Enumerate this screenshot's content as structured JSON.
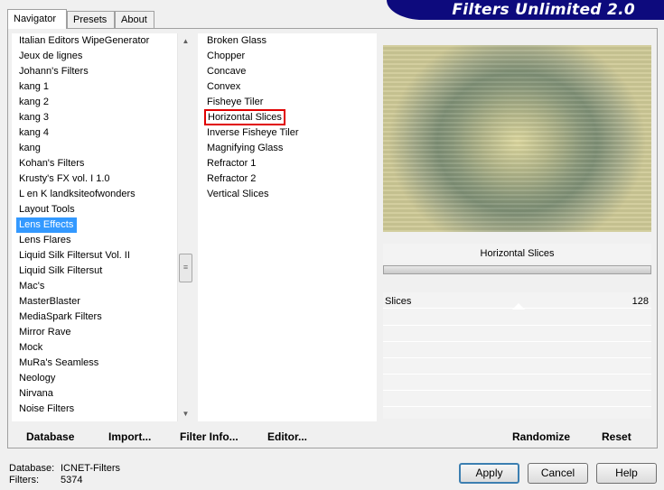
{
  "tabs": [
    "Navigator",
    "Presets",
    "About"
  ],
  "banner_title": "Filters Unlimited 2.0",
  "categories": [
    "Italian Editors WipeGenerator",
    "Jeux de lignes",
    "Johann's Filters",
    "kang 1",
    "kang 2",
    "kang 3",
    "kang 4",
    "kang",
    "Kohan's Filters",
    "Krusty's FX vol. I 1.0",
    "L en K landksiteofwonders",
    "Layout Tools",
    "Lens Effects",
    "Lens Flares",
    "Liquid Silk Filtersut Vol. II",
    "Liquid Silk Filtersut",
    "Mac's",
    "MasterBlaster",
    "MediaSpark Filters",
    "Mirror Rave",
    "Mock",
    "MuRa's Seamless",
    "Neology",
    "Nirvana",
    "Noise Filters"
  ],
  "selected_category": "Lens Effects",
  "filters": [
    "Broken Glass",
    "Chopper",
    "Concave",
    "Convex",
    "Fisheye Tiler",
    "Horizontal Slices",
    "Inverse Fisheye Tiler",
    "Magnifying Glass",
    "Refractor 1",
    "Refractor 2",
    "Vertical Slices"
  ],
  "selected_filter": "Horizontal Slices",
  "preview": {
    "title": "Horizontal Slices",
    "params": [
      {
        "name": "Slices",
        "value": "128"
      }
    ]
  },
  "toolbar": {
    "database": "Database",
    "import": "Import...",
    "filter_info": "Filter Info...",
    "editor": "Editor...",
    "randomize": "Randomize",
    "reset": "Reset"
  },
  "status": {
    "database_label": "Database:",
    "database_value": "ICNET-Filters",
    "filters_label": "Filters:",
    "filters_value": "5374"
  },
  "buttons": {
    "apply": "Apply",
    "cancel": "Cancel",
    "help": "Help"
  }
}
